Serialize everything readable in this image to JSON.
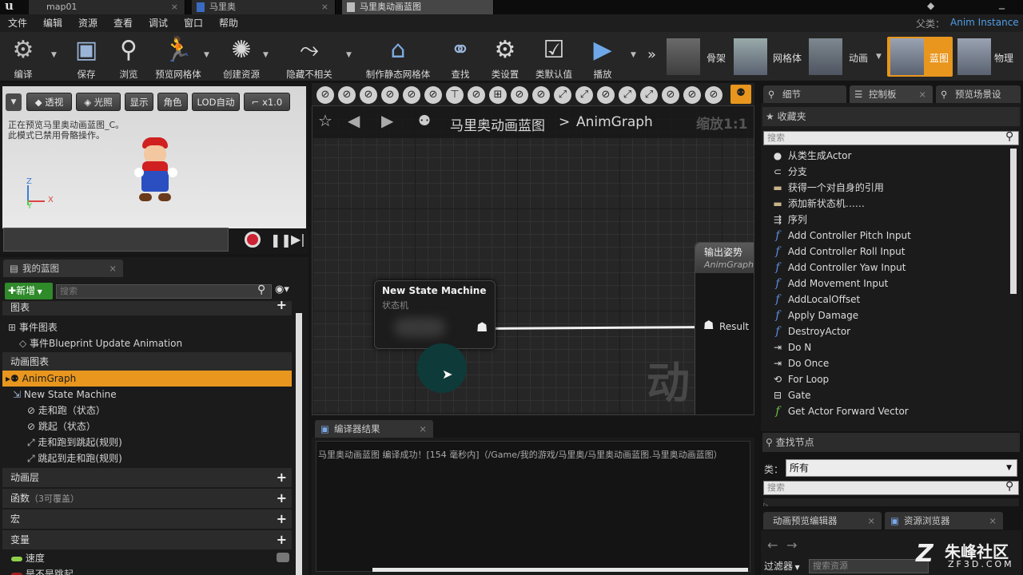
{
  "titlebar": {
    "tabs": [
      {
        "label": "map01"
      },
      {
        "label": "马里奥"
      },
      {
        "label": "马里奥动画蓝图"
      }
    ],
    "parent_label": "父类：",
    "parent_value": "Anim Instance"
  },
  "menu": [
    "文件",
    "编辑",
    "资源",
    "查看",
    "调试",
    "窗口",
    "帮助"
  ],
  "toolbar": {
    "compile": "编译",
    "save": "保存",
    "browse": "浏览",
    "preview_mesh": "预览网格体",
    "create_asset": "创建资源",
    "hide_unrelated": "隐藏不相关",
    "make_static_mesh": "制作静态网格体",
    "find": "查找",
    "class_settings": "类设置",
    "class_defaults": "类默认值",
    "play": "播放",
    "modes": {
      "skeleton": "骨架",
      "mesh": "网格体",
      "animation": "动画",
      "blueprint": "蓝图",
      "physics": "物理"
    }
  },
  "viewport": {
    "buttons": {
      "perspective": "透视",
      "lit": "光照",
      "show": "显示",
      "character": "角色",
      "lod": "LOD自动",
      "speed": "x1.0"
    },
    "notice_line1": "正在预览马里奥动画蓝图_C。",
    "notice_line2": "此模式已禁用骨骼操作。",
    "axis_z": "Z",
    "axis_x": "X",
    "axis_y": "Y"
  },
  "my_blueprint": {
    "tab": "我的蓝图",
    "add_new": "新增",
    "search_placeholder": "搜索",
    "graphs_header": "图表",
    "event_graph": "事件图表",
    "event_update": "事件Blueprint Update Animation",
    "anim_graphs_header": "动画图表",
    "anim_graph": "AnimGraph",
    "state_machine": "New State Machine",
    "states": [
      "走和跑（状态）",
      "跳起（状态）"
    ],
    "rules": [
      "走和跑到跳起(规则)",
      "跳起到走和跑(规则)"
    ],
    "anim_layers": "动画层",
    "functions": "函数",
    "functions_note": "（3可覆盖）",
    "macros": "宏",
    "variables": "变量",
    "vars": [
      "速度",
      "是不是跳起"
    ]
  },
  "graph": {
    "breadcrumb_root": "马里奥动画蓝图",
    "breadcrumb_sep": ">",
    "breadcrumb_leaf": "AnimGraph",
    "zoom": "缩放1:1",
    "watermark": "动画",
    "state_machine_node": {
      "title": "New State Machine",
      "subtitle": "状态机"
    },
    "output_pose_node": {
      "title": "输出姿势",
      "subtitle": "AnimGraph",
      "pin": "Result"
    }
  },
  "compiler": {
    "tab": "编译器结果",
    "message": "马里奥动画蓝图 编译成功！[154 毫秒内]（/Game/我的游戏/马里奥/马里奥动画蓝图.马里奥动画蓝图）"
  },
  "right_panel": {
    "tabs": [
      "细节",
      "控制板",
      "预览场景设"
    ],
    "favorites": "收藏夹",
    "search_placeholder": "搜索",
    "items": [
      {
        "icon": "actor",
        "label": "从类生成Actor"
      },
      {
        "icon": "branch",
        "label": "分支"
      },
      {
        "icon": "node",
        "label": "获得一个对自身的引用"
      },
      {
        "icon": "node",
        "label": "添加新状态机……"
      },
      {
        "icon": "sequence",
        "label": "序列"
      },
      {
        "icon": "function",
        "label": "Add Controller Pitch Input"
      },
      {
        "icon": "function",
        "label": "Add Controller Roll Input"
      },
      {
        "icon": "function",
        "label": "Add Controller Yaw Input"
      },
      {
        "icon": "function",
        "label": "Add Movement Input"
      },
      {
        "icon": "function",
        "label": "AddLocalOffset"
      },
      {
        "icon": "function",
        "label": "Apply Damage"
      },
      {
        "icon": "function",
        "label": "DestroyActor"
      },
      {
        "icon": "flow",
        "label": "Do N"
      },
      {
        "icon": "flow",
        "label": "Do Once"
      },
      {
        "icon": "loop",
        "label": "For Loop"
      },
      {
        "icon": "gate",
        "label": "Gate"
      },
      {
        "icon": "function",
        "label": "Get Actor Forward Vector"
      }
    ],
    "find_nodes": "查找节点",
    "category_label": "类：",
    "category_value": "所有",
    "search2_placeholder": "搜索"
  },
  "bottom_right": {
    "tabs": [
      "动画预览编辑器",
      "资源浏览器"
    ],
    "filter": "过滤器",
    "search_assets": "搜索资源"
  },
  "watermark": {
    "logo_text": "朱峰社区",
    "url": "ZF3D.COM"
  }
}
